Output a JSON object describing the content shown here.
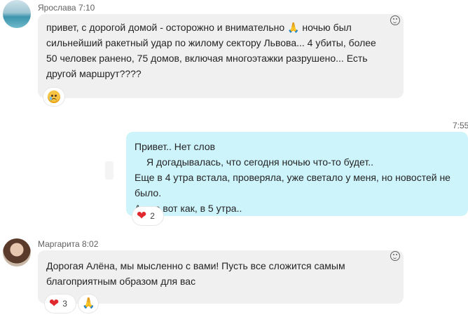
{
  "messages": [
    {
      "sender": "Ярослава",
      "time": "7:10",
      "lines": [
        "привет, с дорогой домой - осторожно и внимательно",
        "ночью был",
        "сильнейший ракетный удар по жилому сектору Львова... 4 убиты, более",
        "50 человек ранено, 75 домов,  включая многоэтажки разрушено... Есть",
        "другой маршрут????"
      ],
      "inline_emoji": "🙏",
      "reaction": {
        "icon": "sad-tear-face-icon"
      }
    },
    {
      "time": "7:55",
      "lines": [
        "Привет..  Нет слов",
        "Я догадывалась, что сегодня ночью что-то будет..",
        "Еще в 4 утра встала, проверяла, уже светало у меня, но новостей не было.",
        "А оно вот как, в 5 утра.."
      ],
      "reaction": {
        "emoji": "❤",
        "count": "2"
      }
    },
    {
      "sender": "Маргарита",
      "time": "8:02",
      "lines": [
        "Дорогая Алёна, мы мысленно с вами! Пусть все сложится самым",
        "благоприятным образом для вас"
      ],
      "reactions": [
        {
          "emoji": "❤",
          "count": "3"
        },
        {
          "emoji": "🙏"
        }
      ]
    }
  ],
  "colors": {
    "incoming_bubble": "#f0f0f0",
    "outgoing_bubble": "#cdf3fb",
    "heart": "#e0282e"
  }
}
